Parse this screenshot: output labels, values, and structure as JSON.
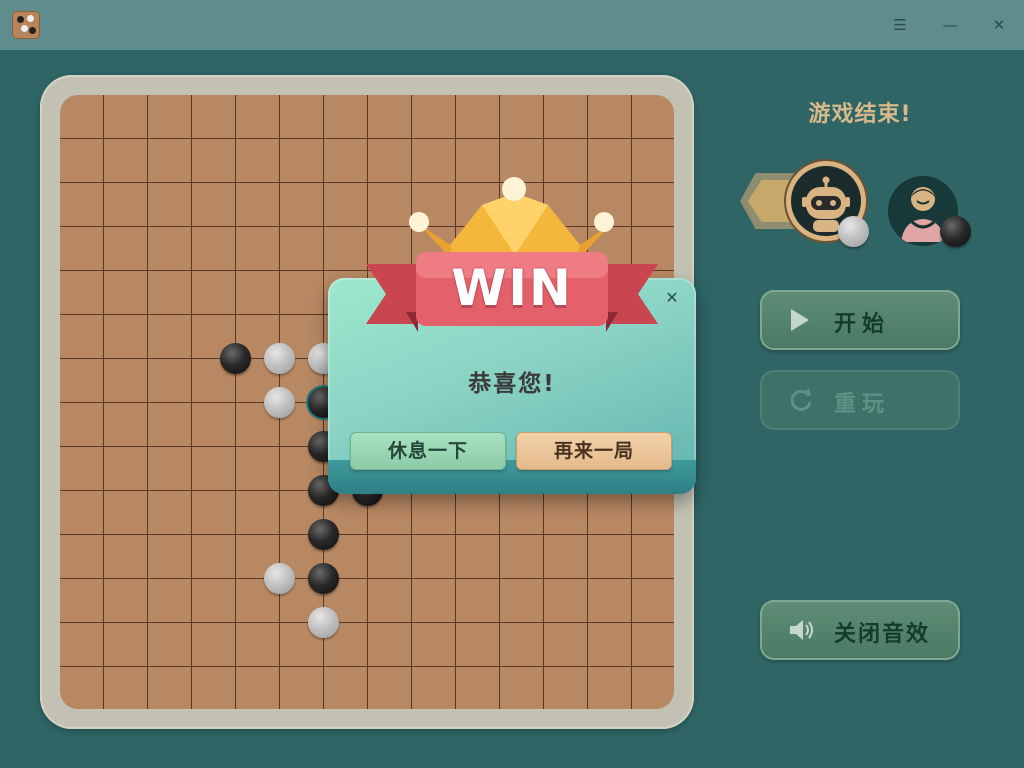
{
  "window": {
    "controls": {
      "menu": "☰",
      "minimize": "—",
      "close": "✕"
    }
  },
  "board": {
    "size": 15,
    "stones": [
      {
        "color": "black",
        "col": 3,
        "row": 5
      },
      {
        "color": "white",
        "col": 4,
        "row": 5
      },
      {
        "color": "white",
        "col": 5,
        "row": 5
      },
      {
        "color": "white",
        "col": 6,
        "row": 5
      },
      {
        "color": "white",
        "col": 4,
        "row": 6
      },
      {
        "color": "black",
        "col": 5,
        "row": 6,
        "last": true
      },
      {
        "color": "black",
        "col": 6,
        "row": 6
      },
      {
        "color": "black",
        "col": 5,
        "row": 7
      },
      {
        "color": "black",
        "col": 5,
        "row": 8
      },
      {
        "color": "black",
        "col": 6,
        "row": 8
      },
      {
        "color": "black",
        "col": 5,
        "row": 9
      },
      {
        "color": "white",
        "col": 4,
        "row": 10
      },
      {
        "color": "black",
        "col": 5,
        "row": 10
      },
      {
        "color": "white",
        "col": 5,
        "row": 11
      }
    ]
  },
  "side_panel": {
    "status": "游戏结束!",
    "players": [
      {
        "icon": "robot-avatar-icon",
        "stone": "white",
        "active": true
      },
      {
        "icon": "user-avatar-icon",
        "stone": "black",
        "active": false
      }
    ],
    "start_label": "开始",
    "replay_label": "重玩",
    "sound_label": "关闭音效"
  },
  "dialog": {
    "banner": "WIN",
    "message": "恭喜您!",
    "rest_label": "休息一下",
    "again_label": "再来一局",
    "close": "✕"
  },
  "colors": {
    "background": "#2f6565",
    "titlebar": "#5f8d8d",
    "board": "#b88862",
    "status": "#d7b98a",
    "ribbon": "#e4606a"
  }
}
